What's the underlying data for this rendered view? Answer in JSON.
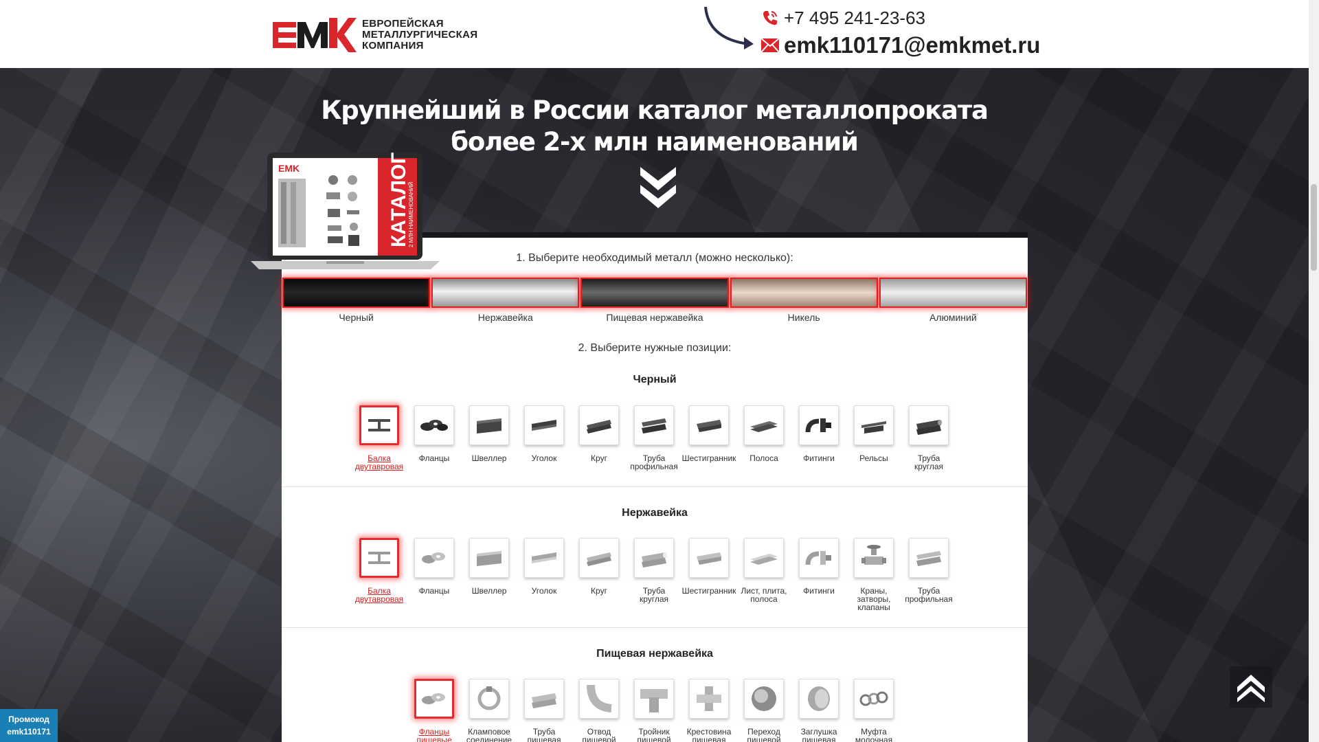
{
  "header": {
    "logo_text_line1": "ЕВРОПЕЙСКАЯ",
    "logo_text_line2": "МЕТАЛЛУРГИЧЕСКАЯ",
    "logo_text_line3": "КОМПАНИЯ",
    "phone": "+7 495 241-23-63",
    "email": "emk110171@emkmet.ru"
  },
  "hero": {
    "title": "Крупнейший в России каталог металлопроката более 2-х млн наименований"
  },
  "laptop": {
    "screen_logo": "EMK",
    "screen_title": "КАТАЛОГ",
    "screen_subtitle": "2 МЛН НАИМЕНОВАНИЙ"
  },
  "step1": "1. Выберите необходимый металл (можно несколько):",
  "metals": [
    {
      "label": "Черный",
      "color": "#111111"
    },
    {
      "label": "Нержавейка",
      "color": "#c8c8c8"
    },
    {
      "label": "Пищевая нержавейка",
      "color": "#3a3a3a"
    },
    {
      "label": "Никель",
      "color": "#c9ae9d"
    },
    {
      "label": "Алюминий",
      "color": "#cfcfcf"
    }
  ],
  "step2": "2. Выберите нужные позиции:",
  "sections": [
    {
      "title": "Черный",
      "items": [
        {
          "l1": "Балка",
          "l2": "двутавровая",
          "active": true
        },
        {
          "l1": "Фланцы",
          "l2": ""
        },
        {
          "l1": "Швеллер",
          "l2": ""
        },
        {
          "l1": "Уголок",
          "l2": ""
        },
        {
          "l1": "Круг",
          "l2": ""
        },
        {
          "l1": "Труба",
          "l2": "профильная"
        },
        {
          "l1": "Шестигранник",
          "l2": ""
        },
        {
          "l1": "Полоса",
          "l2": ""
        },
        {
          "l1": "Фитинги",
          "l2": ""
        },
        {
          "l1": "Рельсы",
          "l2": ""
        },
        {
          "l1": "Труба",
          "l2": "круглая"
        }
      ]
    },
    {
      "title": "Нержавейка",
      "items": [
        {
          "l1": "Балка",
          "l2": "двутавровая",
          "active": true
        },
        {
          "l1": "Фланцы",
          "l2": ""
        },
        {
          "l1": "Швеллер",
          "l2": ""
        },
        {
          "l1": "Уголок",
          "l2": ""
        },
        {
          "l1": "Круг",
          "l2": ""
        },
        {
          "l1": "Труба",
          "l2": "круглая"
        },
        {
          "l1": "Шестигранник",
          "l2": ""
        },
        {
          "l1": "Лист, плита,",
          "l2": "полоса"
        },
        {
          "l1": "Фитинги",
          "l2": ""
        },
        {
          "l1": "Краны,",
          "l2": "затворы,",
          "l3": "клапаны"
        },
        {
          "l1": "Труба",
          "l2": "профильная"
        }
      ]
    },
    {
      "title": "Пищевая нержавейка",
      "items": [
        {
          "l1": "Фланцы",
          "l2": "пищевые",
          "active": true
        },
        {
          "l1": "Кламповое",
          "l2": "соединение"
        },
        {
          "l1": "Труба",
          "l2": "пищевая"
        },
        {
          "l1": "Отвод",
          "l2": "пищевой"
        },
        {
          "l1": "Тройник",
          "l2": "пищевой"
        },
        {
          "l1": "Крестовина",
          "l2": "пищевая"
        },
        {
          "l1": "Переход",
          "l2": "пищевой"
        },
        {
          "l1": "Заглушка",
          "l2": "пищевая"
        },
        {
          "l1": "Муфта",
          "l2": "молочная"
        }
      ]
    }
  ],
  "promo": {
    "line1": "Промокод",
    "line2": "emk110171"
  },
  "colors": {
    "accent": "#e52b2b",
    "promo": "#1a7fb5",
    "brand_red": "#d8262c"
  }
}
